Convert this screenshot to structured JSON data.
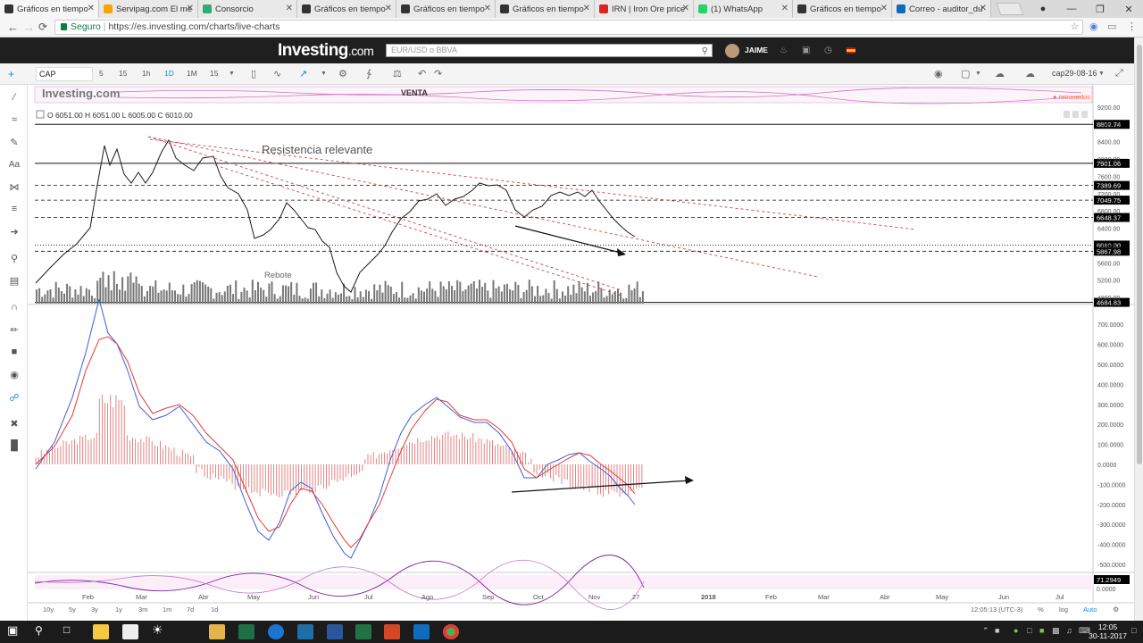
{
  "browser": {
    "tabs": [
      {
        "label": "Gráficos en tiempo",
        "fav": "#333",
        "active": true
      },
      {
        "label": "Servipag.com El me",
        "fav": "#f7a400"
      },
      {
        "label": "Consorcio",
        "fav": "#3a7"
      },
      {
        "label": "Gráficos en tiempo",
        "fav": "#333"
      },
      {
        "label": "Gráficos en tiempo",
        "fav": "#333"
      },
      {
        "label": "Gráficos en tiempo",
        "fav": "#333"
      },
      {
        "label": "IRN | Iron Ore price",
        "fav": "#d22"
      },
      {
        "label": "(1) WhatsApp",
        "fav": "#25d366"
      },
      {
        "label": "Gráficos en tiempo",
        "fav": "#333"
      },
      {
        "label": "Correo - auditor_du",
        "fav": "#0f6cbd"
      }
    ],
    "security_label": "Seguro",
    "url": "https://es.investing.com/charts/live-charts"
  },
  "site": {
    "logo_main": "Investing",
    "logo_suffix": ".com",
    "search_placeholder": "EUR/USD o BBVA",
    "user_name": "JAIME"
  },
  "toolbar": {
    "symbol": "CAP",
    "timeframes": [
      "5",
      "15",
      "1h",
      "1D",
      "1M",
      "15"
    ],
    "selected_timeframe": "1D",
    "layout_name": "cap29-08-16"
  },
  "chart": {
    "watermark": "Investing.com",
    "banner": "VENTA",
    "delayed_label": "● retrasados",
    "ohlc": "O 6051.00  H 6051.00  L 6005.00  C 6010.00",
    "annotations": {
      "resistance": "Resistencia relevante",
      "rebound": "Rebote"
    },
    "price_axis": [
      "9200.00",
      "8800.00",
      "8400.00",
      "8000.00",
      "7600.00",
      "7200.00",
      "6800.00",
      "6400.00",
      "6000.00",
      "5600.00",
      "5200.00",
      "4800.00"
    ],
    "price_tags": [
      {
        "value": "8802.74",
        "line": "solid"
      },
      {
        "value": "7901.06",
        "line": "solid"
      },
      {
        "value": "7389.69",
        "line": "dashed"
      },
      {
        "value": "7049.75",
        "line": "dashed"
      },
      {
        "value": "6648.37",
        "line": "dashed"
      },
      {
        "value": "6010.00",
        "line": "current"
      },
      {
        "value": "5867.98",
        "line": "dashed"
      },
      {
        "value": "4684.83",
        "line": "solid"
      }
    ],
    "macd_axis": [
      "700.0000",
      "600.0000",
      "500.0000",
      "400.0000",
      "300.0000",
      "200.0000",
      "100.0000",
      "0.0000",
      "-100.0000",
      "-200.0000",
      "-300.0000",
      "-400.0000",
      "-500.0000"
    ],
    "rsi_value": "71.2949",
    "rsi_bottom": "0.0000",
    "time_axis": [
      "Feb",
      "Mar",
      "Abr",
      "May",
      "Jun",
      "Jul",
      "Ago",
      "Sep",
      "Oct",
      "Nov",
      "27",
      "2018",
      "Feb",
      "Mar",
      "Abr",
      "May",
      "Jun",
      "Jul"
    ],
    "ranges": [
      "10y",
      "5y",
      "3y",
      "1y",
      "3m",
      "1m",
      "7d",
      "1d"
    ],
    "time_info": "12:05:13 (UTC-3)",
    "bottom_buttons": [
      "%",
      "log",
      "Auto"
    ]
  },
  "taskbar": {
    "time": "12:05",
    "date": "30-11-2017"
  }
}
